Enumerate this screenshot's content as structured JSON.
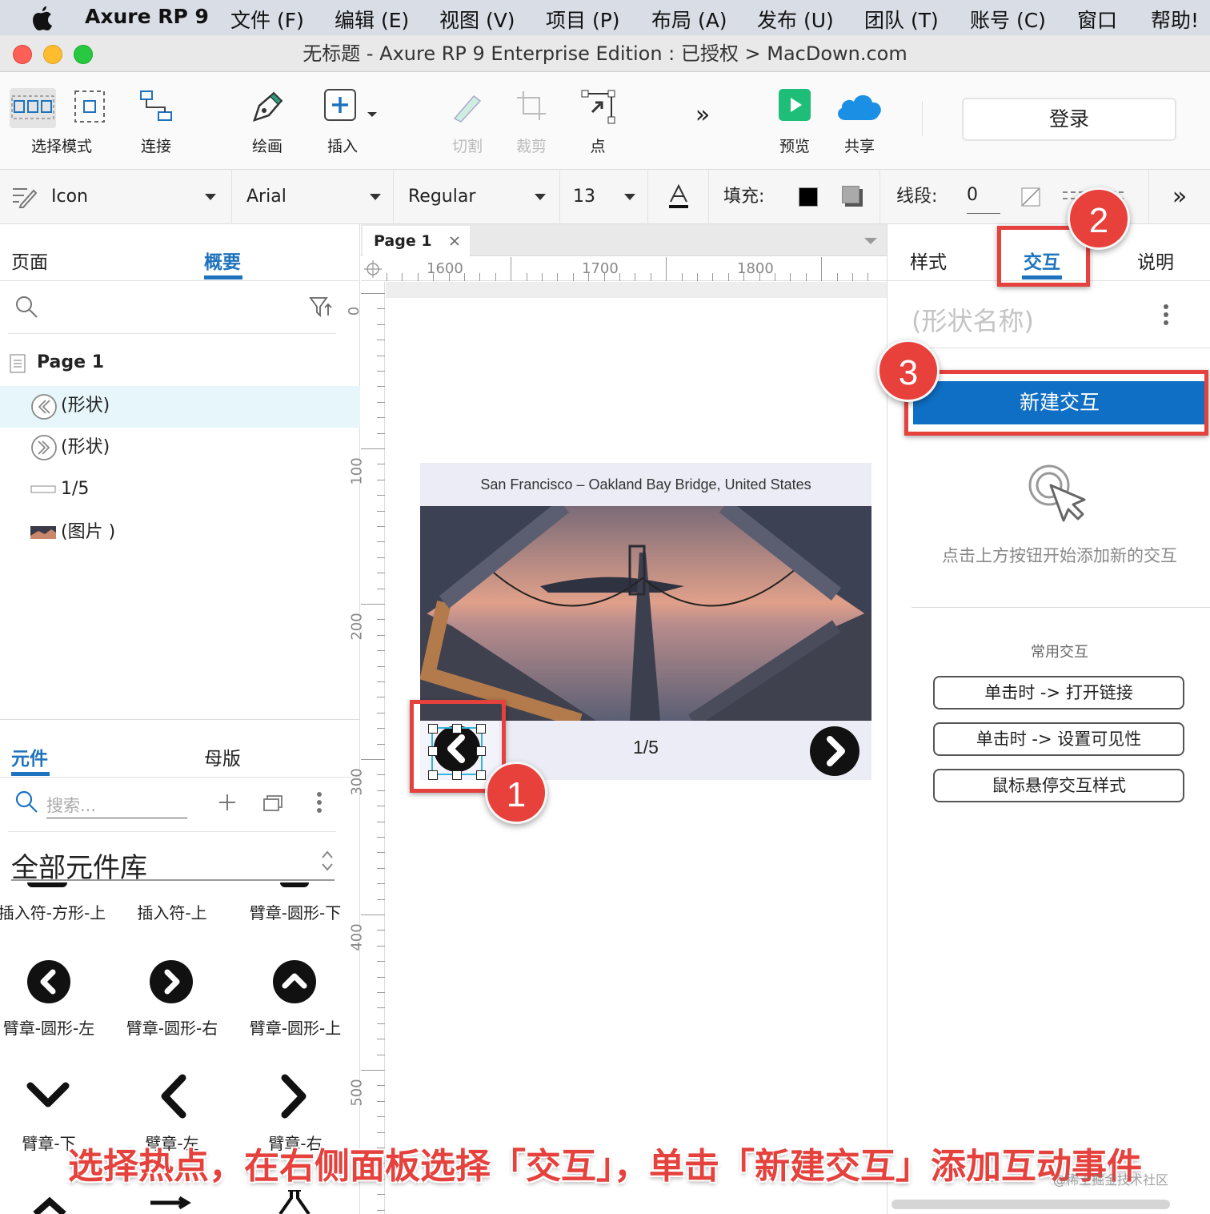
{
  "menubar": {
    "app_name": "Axure RP 9",
    "items": [
      "文件 (F)",
      "编辑 (E)",
      "视图 (V)",
      "项目 (P)",
      "布局 (A)",
      "发布 (U)",
      "团队 (T)",
      "账号 (C)",
      "窗口",
      "帮助!"
    ]
  },
  "window": {
    "title": "无标题 - Axure RP 9 Enterprise Edition : 已授权 > MacDown.com"
  },
  "toolbar": {
    "select_mode": "选择模式",
    "connect": "连接",
    "draw": "绘画",
    "insert": "插入",
    "slice": "切割",
    "crop": "裁剪",
    "point": "点",
    "more": "»",
    "preview": "预览",
    "share": "共享",
    "login": "登录"
  },
  "fontbar": {
    "style_name": "Icon",
    "font": "Arial",
    "weight": "Regular",
    "size": "13",
    "fill_label": "填充:",
    "stroke_label": "线段:",
    "stroke_value": "0",
    "more": "»",
    "fill_color": "#000000",
    "shadow_color": "#555555"
  },
  "left": {
    "tab_pages": "页面",
    "tab_outline": "概要",
    "page_name": "Page 1",
    "outline": [
      "(形状)",
      "(形状)",
      "1/5",
      "(图片 )"
    ],
    "tab_widgets": "元件",
    "tab_masters": "母版",
    "search_placeholder": "搜索...",
    "library": "全部元件库",
    "widgets_row1": [
      "插入符-方形-上",
      "插入符-上",
      "臂章-圆形-下"
    ],
    "widgets_row2": [
      "臂章-圆形-左",
      "臂章-圆形-右",
      "臂章-圆形-上"
    ],
    "widgets_row3": [
      "臂章-下",
      "臂章-左",
      "臂章-右"
    ]
  },
  "canvas": {
    "tab": "Page 1",
    "ruler_x": [
      "1600",
      "1700",
      "1800"
    ],
    "ruler_y": [
      "0",
      "100",
      "200",
      "300",
      "400",
      "500"
    ],
    "caption": "San Francisco – Oakland Bay Bridge, United States",
    "counter": "1/5"
  },
  "right": {
    "tab_style": "样式",
    "tab_interact": "交互",
    "tab_notes": "说明",
    "shape_name_placeholder": "(形状名称)",
    "new_interaction": "新建交互",
    "hint": "点击上方按钮开始添加新的交互",
    "common_title": "常用交互",
    "common": [
      "单击时 -> 打开链接",
      "单击时 -> 设置可见性",
      "鼠标悬停交互样式"
    ]
  },
  "annotations": {
    "badges": [
      "1",
      "2",
      "3"
    ],
    "caption": "选择热点，在右侧面板选择「交互」，单击「新建交互」添加互动事件",
    "watermark": "@稀土掘金技术社区"
  },
  "colors": {
    "accent": "#1e73be",
    "primary_button": "#0f6fc4",
    "annotation_red": "#e5413d"
  }
}
